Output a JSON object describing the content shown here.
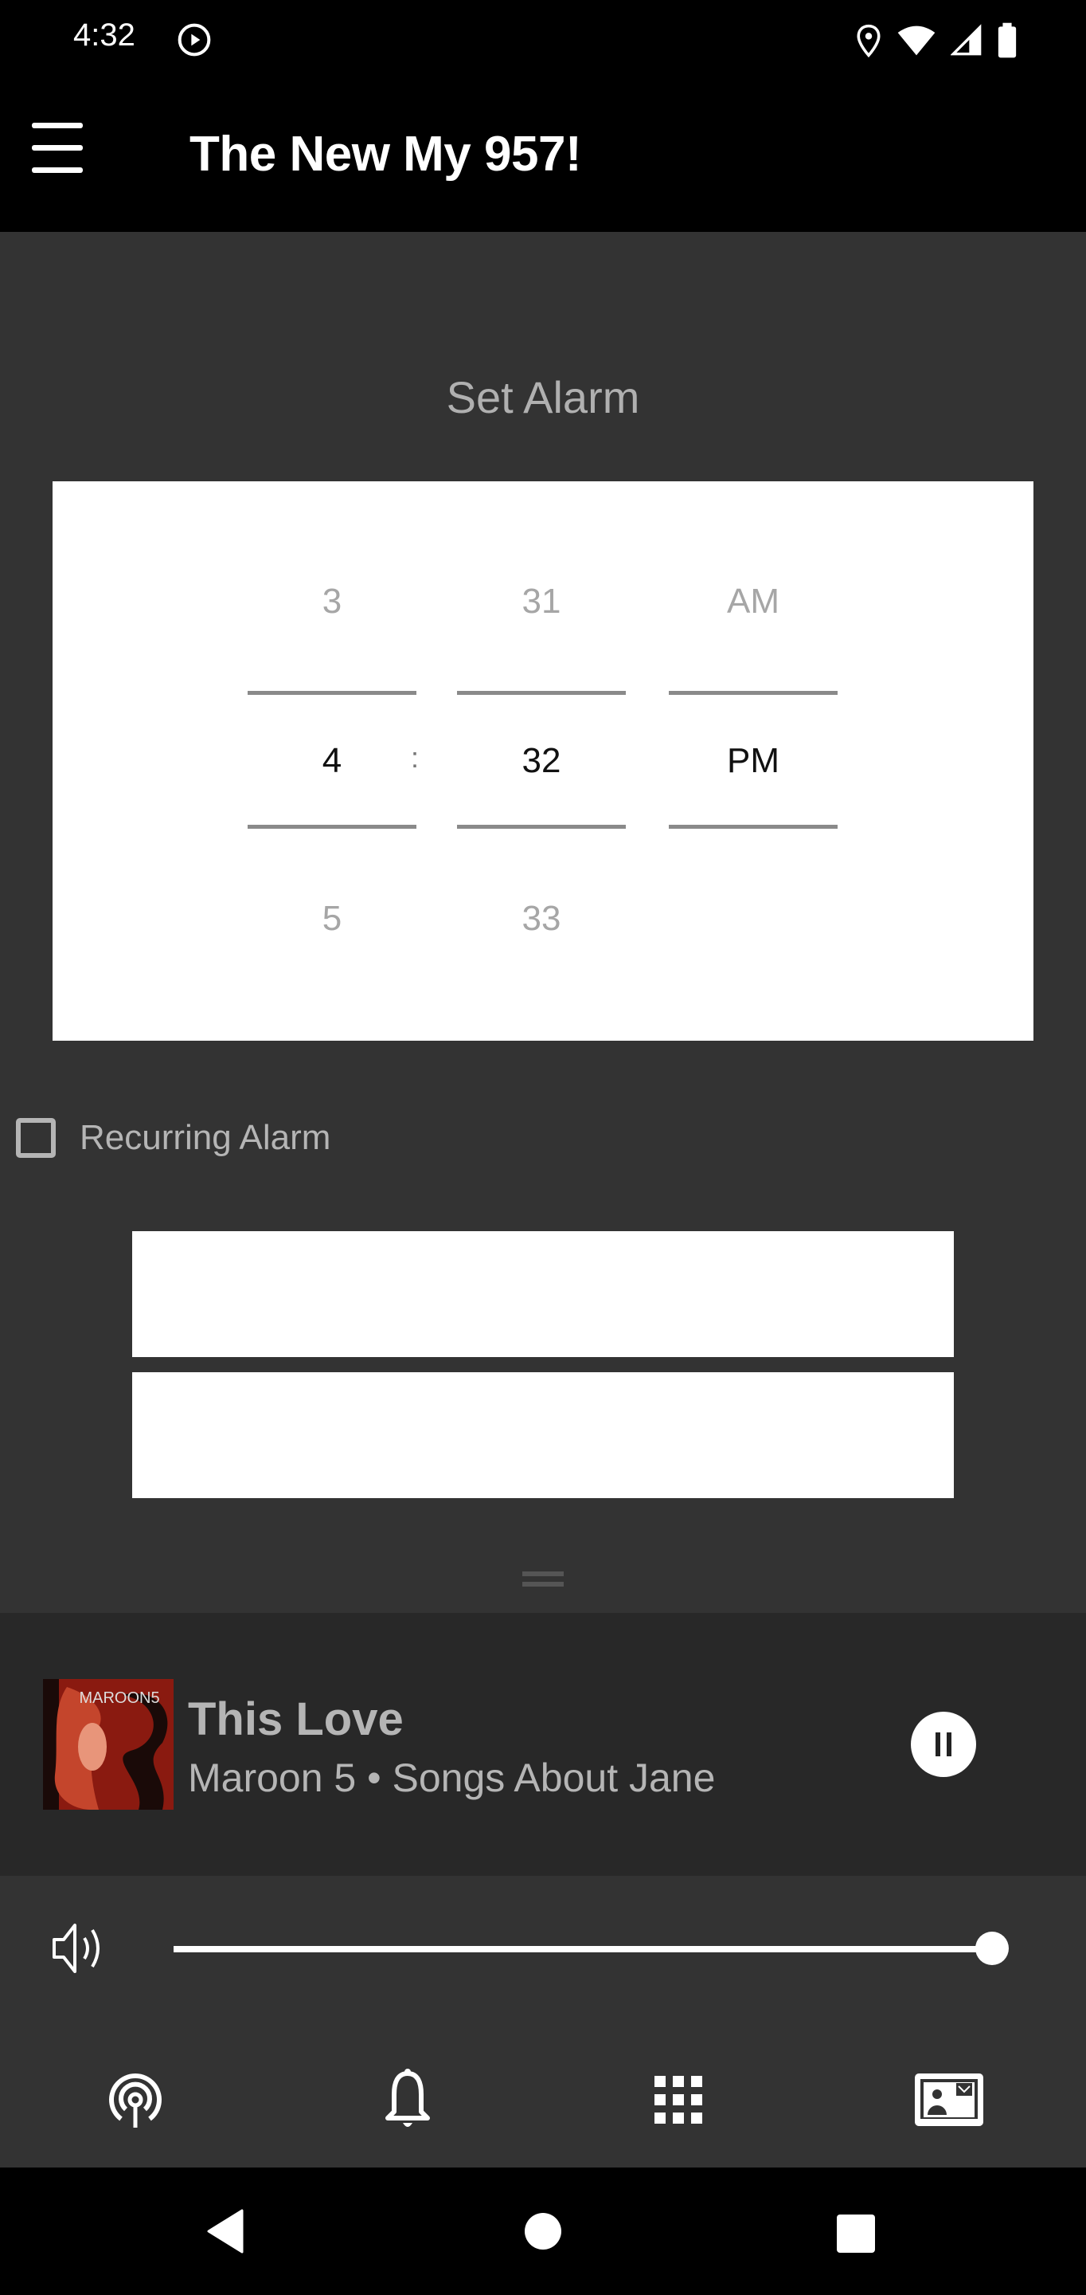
{
  "status_bar": {
    "time": "4:32",
    "left_icons": [
      "play-circle-icon"
    ],
    "right_icons": [
      "location-icon",
      "wifi-icon",
      "signal-icon",
      "battery-icon"
    ]
  },
  "app_bar": {
    "title": "The New My 957!",
    "menu_icon": "hamburger-menu-icon"
  },
  "alarm": {
    "title": "Set Alarm",
    "hour": {
      "above": "3",
      "selected": "4",
      "below": "5"
    },
    "separator": ":",
    "minute": {
      "above": "31",
      "selected": "32",
      "below": "33"
    },
    "period": {
      "above": "AM",
      "selected": "PM",
      "below": ""
    },
    "recurring": {
      "label": "Recurring Alarm",
      "checked": false
    },
    "buttons": [
      {
        "label": ""
      },
      {
        "label": ""
      }
    ]
  },
  "now_playing": {
    "title": "This Love",
    "subtitle": "Maroon 5 • Songs About Jane",
    "album_art": "Maroon 5 - Songs About Jane cover",
    "state": "playing",
    "control_icon": "pause-icon"
  },
  "volume": {
    "icon": "volume-icon",
    "level_percent": 100
  },
  "bottom_nav": [
    {
      "name": "listen-live",
      "icon": "podcast-broadcast-icon"
    },
    {
      "name": "alarm",
      "icon": "bell-icon"
    },
    {
      "name": "more",
      "icon": "grid-icon"
    },
    {
      "name": "contact",
      "icon": "contact-card-icon"
    }
  ],
  "system_nav": [
    "back-icon",
    "home-icon",
    "recents-icon"
  ]
}
